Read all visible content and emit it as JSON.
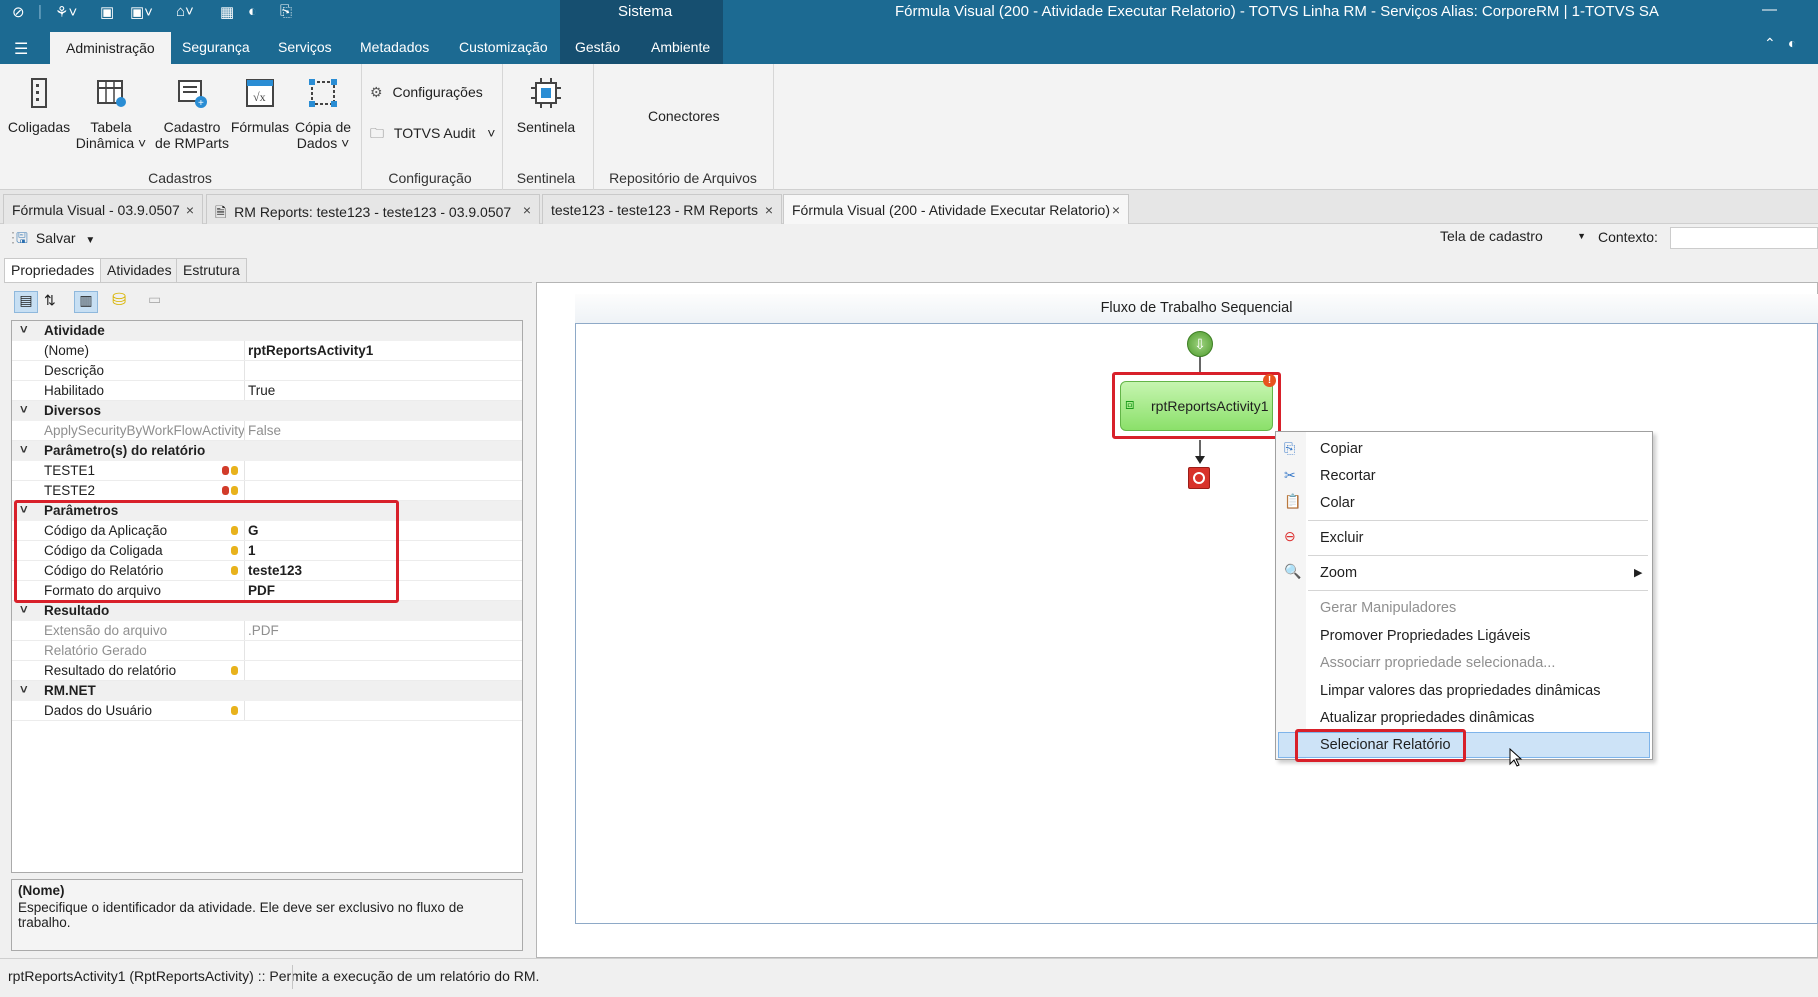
{
  "window": {
    "sistema": "Sistema",
    "title": "Fórmula Visual (200 - Atividade Executar Relatorio) - TOTVS Linha RM - Serviços  Alias: CorporeRM | 1-TOTVS SA",
    "minimize": "—"
  },
  "ribbon_tabs": [
    "Administração",
    "Segurança",
    "Serviços",
    "Metadados",
    "Customização",
    "Gestão",
    "Ambiente"
  ],
  "ribbon": {
    "coligadas": "Coligadas",
    "tabela_dinamica_1": "Tabela",
    "tabela_dinamica_2": "Dinâmica",
    "cadastro_rmparts_1": "Cadastro",
    "cadastro_rmparts_2": "de RMParts",
    "formulas": "Fórmulas",
    "copia_dados_1": "Cópia de",
    "copia_dados_2": "Dados",
    "configuracoes": "Configurações",
    "totvs_audit": "TOTVS Audit",
    "sentinela": "Sentinela",
    "conectores": "Conectores",
    "groups": {
      "cadastros": "Cadastros",
      "configuracao": "Configuração",
      "sentinela": "Sentinela",
      "repositorio": "Repositório de Arquivos"
    }
  },
  "doc_tabs": [
    "Fórmula Visual - 03.9.0507",
    "RM Reports: teste123 - teste123 - 03.9.0507",
    "teste123 - teste123 - RM Reports",
    "Fórmula Visual (200 - Atividade Executar Relatorio)"
  ],
  "toolbar": {
    "salvar": "Salvar",
    "tela_cadastro": "Tela de cadastro",
    "contexto": "Contexto:"
  },
  "panel_tabs": [
    "Propriedades",
    "Atividades",
    "Estrutura"
  ],
  "properties": {
    "atividade": "Atividade",
    "nome_label": "(Nome)",
    "nome_value": "rptReportsActivity1",
    "descricao": "Descrição",
    "habilitado": "Habilitado",
    "habilitado_value": "True",
    "diversos": "Diversos",
    "apply_security": "ApplySecurityByWorkFlowActivity",
    "apply_security_value": "False",
    "parametros_relatorio": "Parâmetro(s) do relatório",
    "teste1": "TESTE1",
    "teste2": "TESTE2",
    "parametros": "Parâmetros",
    "cod_aplicacao": "Código da Aplicação",
    "cod_aplicacao_value": "G",
    "cod_coligada": "Código da Coligada",
    "cod_coligada_value": "1",
    "cod_relatorio": "Código do Relatório",
    "cod_relatorio_value": "teste123",
    "formato_arquivo": "Formato do arquivo",
    "formato_arquivo_value": "PDF",
    "resultado": "Resultado",
    "extensao_arquivo": "Extensão do arquivo",
    "extensao_arquivo_value": ".PDF",
    "relatorio_gerado": "Relatório Gerado",
    "resultado_relatorio": "Resultado do relatório",
    "rmnet": "RM.NET",
    "dados_usuario": "Dados do Usuário"
  },
  "description": {
    "title": "(Nome)",
    "text": "Especifique o identificador da atividade. Ele deve ser exclusivo no fluxo de trabalho."
  },
  "workflow": {
    "title": "Fluxo de Trabalho Sequencial",
    "activity_name": "rptReportsActivity1"
  },
  "context_menu": {
    "copiar": "Copiar",
    "recortar": "Recortar",
    "colar": "Colar",
    "excluir": "Excluir",
    "zoom": "Zoom",
    "gerar_manipuladores": "Gerar Manipuladores",
    "promover": "Promover Propriedades Ligáveis",
    "associar": "Associarr propriedade selecionada...",
    "limpar": "Limpar valores das propriedades dinâmicas",
    "atualizar": "Atualizar propriedades dinâmicas",
    "selecionar": "Selecionar Relatório"
  },
  "statusbar": {
    "text": "rptReportsActivity1  (RptReportsActivity)  :: Permite a execução de um relatório do RM."
  },
  "colors": {
    "title_bar": "#1c6a92",
    "highlight_red": "#d8202a",
    "activity_green": "#a7ec8c",
    "menu_selection": "#cde3f7"
  }
}
